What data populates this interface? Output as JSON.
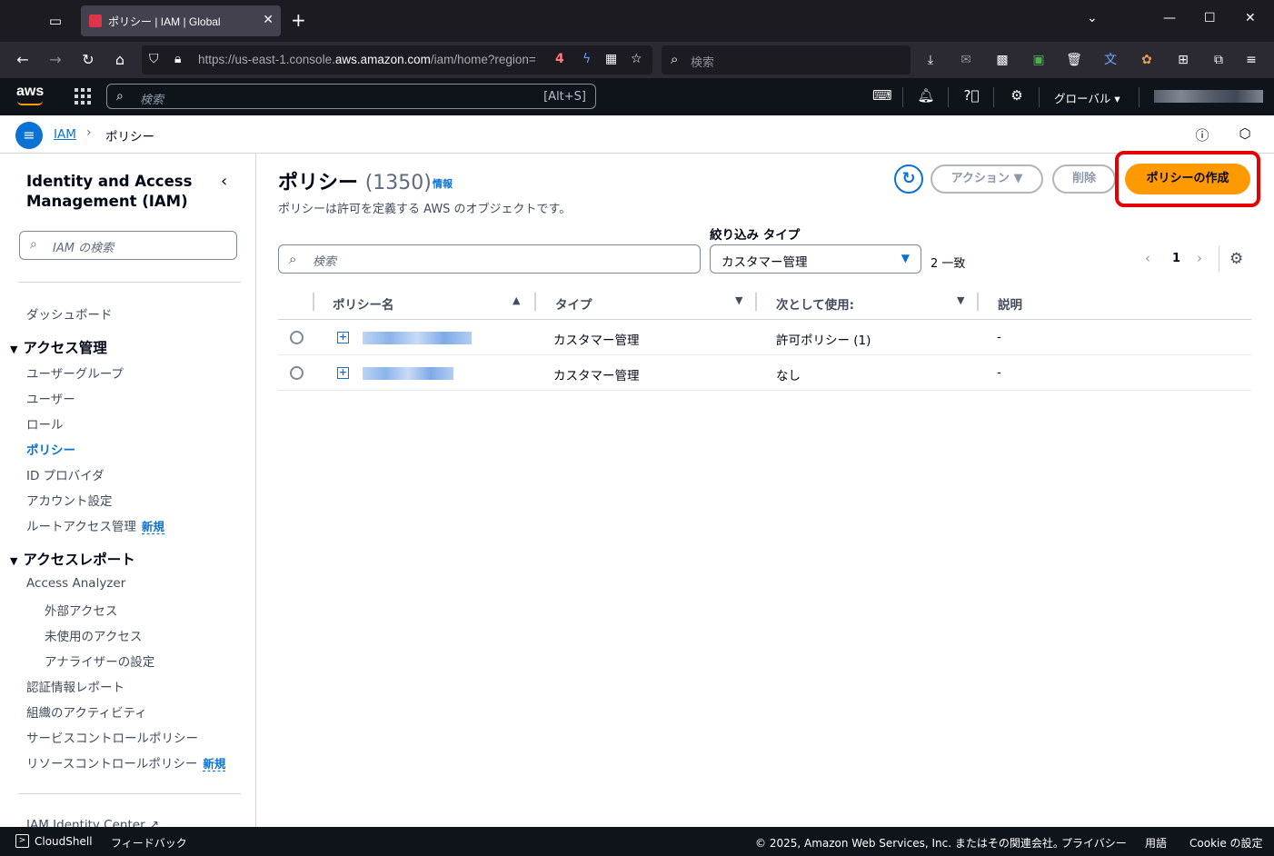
{
  "browser": {
    "tab_title": "ポリシー | IAM | Global",
    "url_prefix": "https://us-east-1.console.",
    "url_domain": "aws.amazon.com",
    "url_suffix": "/iam/home?region=",
    "search_placeholder": "検索"
  },
  "aws_header": {
    "logo": "aws",
    "search_placeholder": "検索",
    "search_shortcut": "[Alt+S]",
    "region": "グローバル ▾"
  },
  "breadcrumb": {
    "root": "IAM",
    "current": "ポリシー"
  },
  "sidebar": {
    "title": "Identity and Access Management (IAM)",
    "search_placeholder": "IAM の検索",
    "dashboard": "ダッシュボード",
    "access_mgmt": {
      "label": "アクセス管理",
      "items": [
        "ユーザーグループ",
        "ユーザー",
        "ロール",
        "ポリシー",
        "ID プロバイダ",
        "アカウント設定",
        "ルートアクセス管理"
      ]
    },
    "access_reports": {
      "label": "アクセスレポート",
      "analyzer": "Access Analyzer",
      "analyzer_items": [
        "外部アクセス",
        "未使用のアクセス",
        "アナライザーの設定"
      ],
      "items": [
        "認証情報レポート",
        "組織のアクティビティ",
        "サービスコントロールポリシー",
        "リソースコントロールポリシー"
      ]
    },
    "new_badge": "新規",
    "identity_center": "IAM Identity Center"
  },
  "main": {
    "title": "ポリシー",
    "count": "(1350)",
    "info_link": "情報",
    "description": "ポリシーは許可を定義する AWS のオブジェクトです。",
    "actions_button": "アクション ▼",
    "delete_button": "削除",
    "create_button": "ポリシーの作成",
    "filter_label": "絞り込み タイプ",
    "search_placeholder": "検索",
    "filter_value": "カスタマー管理",
    "matches": "2 一致",
    "page": "1"
  },
  "table": {
    "columns": [
      "ポリシー名",
      "タイプ",
      "次として使用:",
      "説明"
    ],
    "rows": [
      {
        "type": "カスタマー管理",
        "used_as": "許可ポリシー (1)",
        "description": "-"
      },
      {
        "type": "カスタマー管理",
        "used_as": "なし",
        "description": "-"
      }
    ]
  },
  "footer": {
    "cloudshell": "CloudShell",
    "feedback": "フィードバック",
    "copyright": "© 2025, Amazon Web Services, Inc. またはその関連会社。",
    "privacy": "プライバシー",
    "terms": "用語",
    "cookie": "Cookie の設定"
  }
}
